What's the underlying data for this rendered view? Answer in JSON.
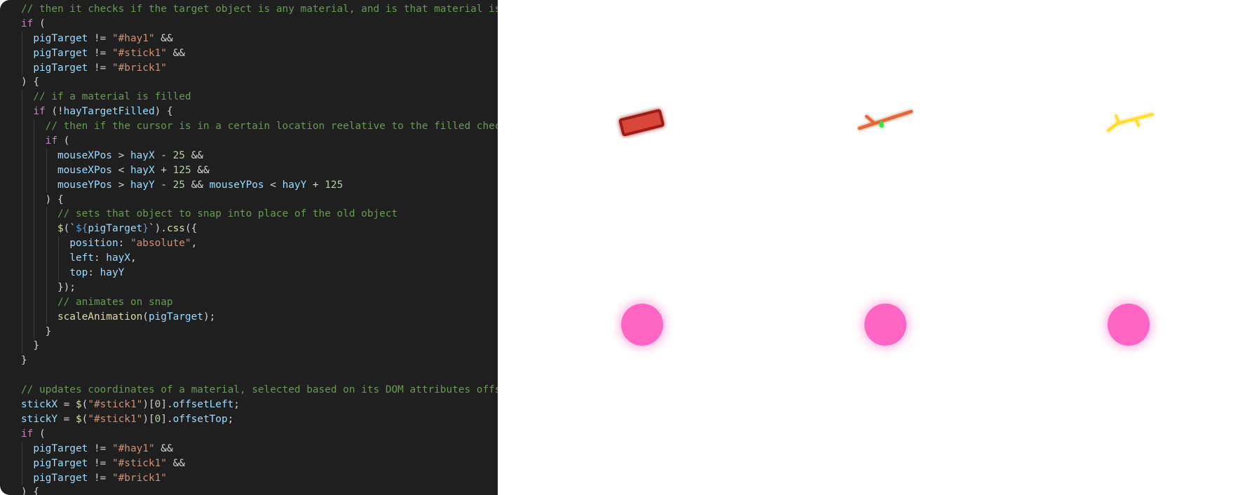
{
  "editor": {
    "lines": [
      [
        {
          "t": "// then it checks if the target object is any material, and is that material is f",
          "c": "cm"
        }
      ],
      [
        {
          "t": "if",
          "c": "kw"
        },
        {
          "t": " (",
          "c": "pun"
        }
      ],
      [
        {
          "t": "  ",
          "c": "pun"
        },
        {
          "t": "pigTarget",
          "c": "var"
        },
        {
          "t": " != ",
          "c": "op"
        },
        {
          "t": "\"#hay1\"",
          "c": "str"
        },
        {
          "t": " &&",
          "c": "op"
        }
      ],
      [
        {
          "t": "  ",
          "c": "pun"
        },
        {
          "t": "pigTarget",
          "c": "var"
        },
        {
          "t": " != ",
          "c": "op"
        },
        {
          "t": "\"#stick1\"",
          "c": "str"
        },
        {
          "t": " &&",
          "c": "op"
        }
      ],
      [
        {
          "t": "  ",
          "c": "pun"
        },
        {
          "t": "pigTarget",
          "c": "var"
        },
        {
          "t": " != ",
          "c": "op"
        },
        {
          "t": "\"#brick1\"",
          "c": "str"
        }
      ],
      [
        {
          "t": ") {",
          "c": "pun"
        }
      ],
      [
        {
          "t": "  // if a material is filled",
          "c": "cm"
        }
      ],
      [
        {
          "t": "  ",
          "c": "pun"
        },
        {
          "t": "if",
          "c": "kw"
        },
        {
          "t": " (!",
          "c": "pun"
        },
        {
          "t": "hayTargetFilled",
          "c": "var"
        },
        {
          "t": ") {",
          "c": "pun"
        }
      ],
      [
        {
          "t": "    // then if the cursor is in a certain location reelative to the filled checke",
          "c": "cm"
        }
      ],
      [
        {
          "t": "    ",
          "c": "pun"
        },
        {
          "t": "if",
          "c": "kw"
        },
        {
          "t": " (",
          "c": "pun"
        }
      ],
      [
        {
          "t": "      ",
          "c": "pun"
        },
        {
          "t": "mouseXPos",
          "c": "var"
        },
        {
          "t": " > ",
          "c": "op"
        },
        {
          "t": "hayX",
          "c": "var"
        },
        {
          "t": " - ",
          "c": "op"
        },
        {
          "t": "25",
          "c": "num"
        },
        {
          "t": " &&",
          "c": "op"
        }
      ],
      [
        {
          "t": "      ",
          "c": "pun"
        },
        {
          "t": "mouseXPos",
          "c": "var"
        },
        {
          "t": " < ",
          "c": "op"
        },
        {
          "t": "hayX",
          "c": "var"
        },
        {
          "t": " + ",
          "c": "op"
        },
        {
          "t": "125",
          "c": "num"
        },
        {
          "t": " &&",
          "c": "op"
        }
      ],
      [
        {
          "t": "      ",
          "c": "pun"
        },
        {
          "t": "mouseYPos",
          "c": "var"
        },
        {
          "t": " > ",
          "c": "op"
        },
        {
          "t": "hayY",
          "c": "var"
        },
        {
          "t": " - ",
          "c": "op"
        },
        {
          "t": "25",
          "c": "num"
        },
        {
          "t": " && ",
          "c": "op"
        },
        {
          "t": "mouseYPos",
          "c": "var"
        },
        {
          "t": " < ",
          "c": "op"
        },
        {
          "t": "hayY",
          "c": "var"
        },
        {
          "t": " + ",
          "c": "op"
        },
        {
          "t": "125",
          "c": "num"
        }
      ],
      [
        {
          "t": "    ) {",
          "c": "pun"
        }
      ],
      [
        {
          "t": "      // sets that object to snap into place of the old object",
          "c": "cm"
        }
      ],
      [
        {
          "t": "      ",
          "c": "pun"
        },
        {
          "t": "$",
          "c": "fn"
        },
        {
          "t": "(`",
          "c": "pun"
        },
        {
          "t": "${",
          "c": "tpl"
        },
        {
          "t": "pigTarget",
          "c": "var"
        },
        {
          "t": "}",
          "c": "tpl"
        },
        {
          "t": "`).",
          "c": "pun"
        },
        {
          "t": "css",
          "c": "fn"
        },
        {
          "t": "({",
          "c": "pun"
        }
      ],
      [
        {
          "t": "        ",
          "c": "pun"
        },
        {
          "t": "position",
          "c": "var"
        },
        {
          "t": ": ",
          "c": "pun"
        },
        {
          "t": "\"absolute\"",
          "c": "str"
        },
        {
          "t": ",",
          "c": "pun"
        }
      ],
      [
        {
          "t": "        ",
          "c": "pun"
        },
        {
          "t": "left",
          "c": "var"
        },
        {
          "t": ": ",
          "c": "pun"
        },
        {
          "t": "hayX",
          "c": "var"
        },
        {
          "t": ",",
          "c": "pun"
        }
      ],
      [
        {
          "t": "        ",
          "c": "pun"
        },
        {
          "t": "top",
          "c": "var"
        },
        {
          "t": ": ",
          "c": "pun"
        },
        {
          "t": "hayY",
          "c": "var"
        }
      ],
      [
        {
          "t": "      });",
          "c": "pun"
        }
      ],
      [
        {
          "t": "      // animates on snap",
          "c": "cm"
        }
      ],
      [
        {
          "t": "      ",
          "c": "pun"
        },
        {
          "t": "scaleAnimation",
          "c": "fn"
        },
        {
          "t": "(",
          "c": "pun"
        },
        {
          "t": "pigTarget",
          "c": "var"
        },
        {
          "t": ");",
          "c": "pun"
        }
      ],
      [
        {
          "t": "    }",
          "c": "pun"
        }
      ],
      [
        {
          "t": "  }",
          "c": "pun"
        }
      ],
      [
        {
          "t": "}",
          "c": "pun"
        }
      ],
      [],
      [
        {
          "t": "// updates coordinates of a material, selected based on its DOM attributes offset",
          "c": "cm"
        }
      ],
      [
        {
          "t": "stickX",
          "c": "var"
        },
        {
          "t": " = ",
          "c": "op"
        },
        {
          "t": "$",
          "c": "fn"
        },
        {
          "t": "(",
          "c": "pun"
        },
        {
          "t": "\"#stick1\"",
          "c": "str"
        },
        {
          "t": ")[",
          "c": "pun"
        },
        {
          "t": "0",
          "c": "num"
        },
        {
          "t": "].",
          "c": "pun"
        },
        {
          "t": "offsetLeft",
          "c": "var"
        },
        {
          "t": ";",
          "c": "pun"
        }
      ],
      [
        {
          "t": "stickY",
          "c": "var"
        },
        {
          "t": " = ",
          "c": "op"
        },
        {
          "t": "$",
          "c": "fn"
        },
        {
          "t": "(",
          "c": "pun"
        },
        {
          "t": "\"#stick1\"",
          "c": "str"
        },
        {
          "t": ")[",
          "c": "pun"
        },
        {
          "t": "0",
          "c": "num"
        },
        {
          "t": "].",
          "c": "pun"
        },
        {
          "t": "offsetTop",
          "c": "var"
        },
        {
          "t": ";",
          "c": "pun"
        }
      ],
      [
        {
          "t": "if",
          "c": "kw"
        },
        {
          "t": " (",
          "c": "pun"
        }
      ],
      [
        {
          "t": "  ",
          "c": "pun"
        },
        {
          "t": "pigTarget",
          "c": "var"
        },
        {
          "t": " != ",
          "c": "op"
        },
        {
          "t": "\"#hay1\"",
          "c": "str"
        },
        {
          "t": " &&",
          "c": "op"
        }
      ],
      [
        {
          "t": "  ",
          "c": "pun"
        },
        {
          "t": "pigTarget",
          "c": "var"
        },
        {
          "t": " != ",
          "c": "op"
        },
        {
          "t": "\"#stick1\"",
          "c": "str"
        },
        {
          "t": " &&",
          "c": "op"
        }
      ],
      [
        {
          "t": "  ",
          "c": "pun"
        },
        {
          "t": "pigTarget",
          "c": "var"
        },
        {
          "t": " != ",
          "c": "op"
        },
        {
          "t": "\"#brick1\"",
          "c": "str"
        }
      ],
      [
        {
          "t": ") {",
          "c": "pun"
        }
      ]
    ]
  },
  "canvas": {
    "materials": [
      {
        "name": "brick-material",
        "icon": "brick-icon",
        "color": "#d9473a"
      },
      {
        "name": "stick-material",
        "icon": "stick-icon",
        "color": "#e0683a"
      },
      {
        "name": "hay-material",
        "icon": "hay-icon",
        "color": "#ffdd33"
      }
    ],
    "pigs": [
      {
        "name": "pig-1",
        "color": "#ff66c4"
      },
      {
        "name": "pig-2",
        "color": "#ff66c4"
      },
      {
        "name": "pig-3",
        "color": "#ff66c4"
      }
    ]
  },
  "colors": {
    "editor_bg": "#1f1f1f",
    "comment": "#6a9955",
    "keyword": "#c586c0",
    "variable": "#9cdcfe",
    "string": "#ce9178",
    "number": "#b5cea8",
    "function": "#dcdcaa",
    "pig": "#ff66c4"
  }
}
